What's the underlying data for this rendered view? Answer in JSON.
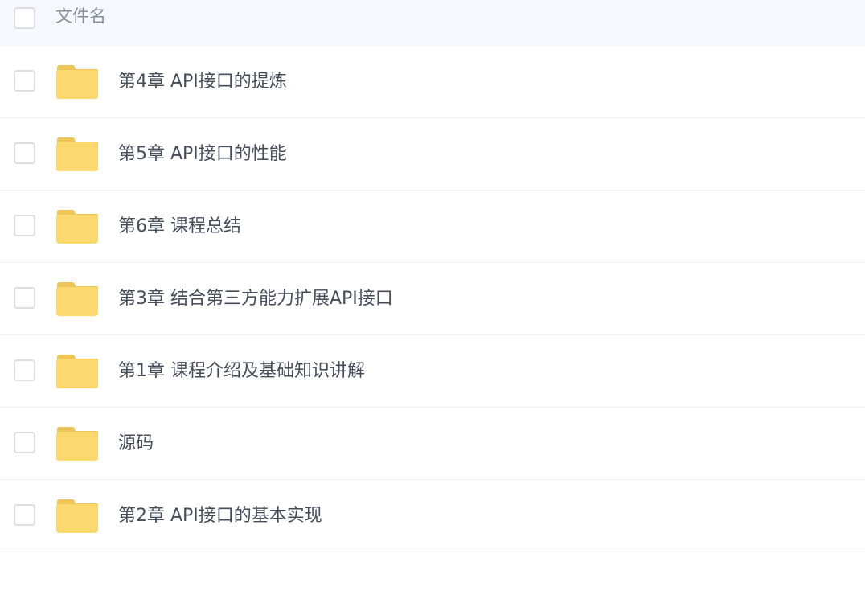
{
  "header": {
    "column_label": "文件名"
  },
  "files": [
    {
      "name": "第4章 API接口的提炼",
      "icon": "folder-icon"
    },
    {
      "name": "第5章 API接口的性能",
      "icon": "folder-icon"
    },
    {
      "name": "第6章 课程总结",
      "icon": "folder-icon"
    },
    {
      "name": "第3章 结合第三方能力扩展API接口",
      "icon": "folder-icon"
    },
    {
      "name": "第1章 课程介绍及基础知识讲解",
      "icon": "folder-icon"
    },
    {
      "name": "源码",
      "icon": "folder-icon"
    },
    {
      "name": "第2章 API接口的基本实现",
      "icon": "folder-icon"
    }
  ],
  "colors": {
    "header_bg": "#f5f9fe",
    "folder_body": "#fcd96f",
    "folder_tab": "#f0c557",
    "text": "#454d5a",
    "muted_text": "#878c9c"
  }
}
